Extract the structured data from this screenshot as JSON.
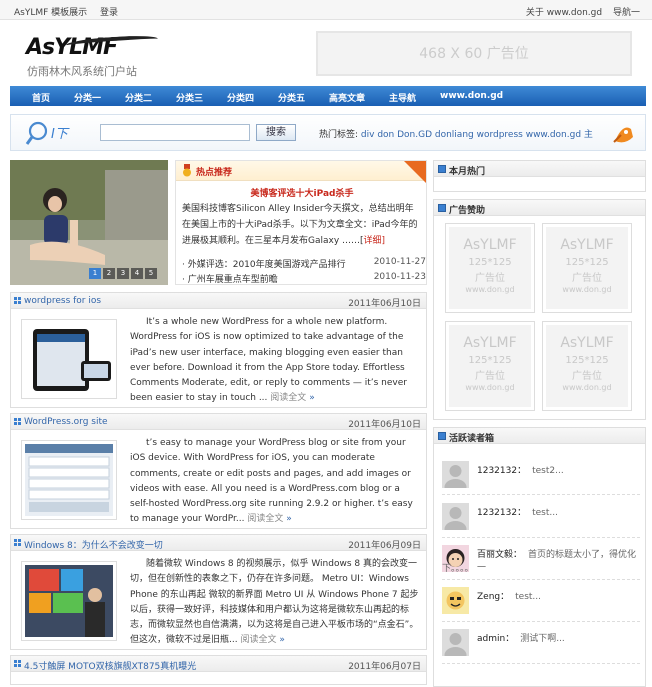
{
  "topbar": {
    "links": [
      "AsYLMF 模板展示",
      "登录"
    ],
    "right": [
      "关于 www.don.gd",
      "导航一"
    ]
  },
  "header": {
    "logo": "AsYLMF",
    "tagline": "仿雨林木风系统门户站",
    "ad": "468 X 60 广告位"
  },
  "nav": [
    "首页",
    "分类一",
    "分类二",
    "分类三",
    "分类四",
    "分类五",
    "高亮文章",
    "主导航",
    "www.don.gd"
  ],
  "search": {
    "button": "搜索",
    "tags_label": "热门标签:",
    "tags": "div don Don.GD donliang wordpress www.don.gd 主"
  },
  "slider": {
    "pages": [
      "1",
      "2",
      "3",
      "4",
      "5"
    ]
  },
  "hot": {
    "header": "热点推荐",
    "title": "美博客评选十大iPad杀手",
    "desc": "美国科技博客Silicon Alley Insider今天撰文，总结出明年在美国上市的十大iPad杀手。以下为文章全文：iPad今年的进展极其顺利。在三星本月发布Galaxy ……[",
    "more": "详细",
    "list": [
      {
        "title": "· 外媒评选：2010年度美国游戏产品排行",
        "date": "2010-11-27"
      },
      {
        "title": "· 广州车展重点车型前瞻",
        "date": "2010-11-23"
      }
    ]
  },
  "posts": [
    {
      "title": "wordpress for ios",
      "date": "2011年06月10日",
      "body": "It’s a whole new WordPress for a whole new platform. WordPress for iOS is now optimized to take advantage of the iPad’s new user interface, making blogging even easier than ever before. Download it from the App Store today. Effortless Comments Moderate, edit, or reply to comments — it’s never been easier to stay in touch ...",
      "read": "阅读全文",
      "arrow": "»"
    },
    {
      "title": "WordPress.org site",
      "date": "2011年06月10日",
      "body": "t’s easy to manage your WordPress blog or site from your iOS device. With WordPress for iOS, you can moderate comments, create or edit posts and pages, and add images or videos with ease. All you need is a WordPress.com blog or a self-hosted WordPress.org site running 2.9.2 or higher. t’s easy to manage your WordPr...",
      "read": "阅读全文",
      "arrow": "»"
    },
    {
      "title": "Windows 8：为什么不会改变一切",
      "date": "2011年06月09日",
      "body": "随着微软 Windows 8 的视频展示，似乎 Windows 8 真的会改变一切，但在创新性的表象之下，仍存在许多问题。 Metro UI：Windows Phone 的东山再起 微软的新界面 Metro UI 从 Windows Phone 7 起步以后，获得一致好评，科技媒体和用户都认为这将是微软东山再起的标志，而微软显然也自信满满，以为这将是自己进入平板市场的“点金石”。 但这次，微软不过是旧瓶...",
      "read": "阅读全文",
      "arrow": "»"
    },
    {
      "title": "4.5寸触屏 MOTO双核旗舰XT875真机曝光",
      "date": "2011年06月07日"
    }
  ],
  "sidebar": {
    "hot_title": "本月热门",
    "ad_title": "广告赞助",
    "ads": [
      {
        "name": "AsYLMF",
        "size": "125*125",
        "label": "广告位",
        "url": "www.don.gd"
      },
      {
        "name": "AsYLMF",
        "size": "125*125",
        "label": "广告位",
        "url": "www.don.gd"
      },
      {
        "name": "AsYLMF",
        "size": "125*125",
        "label": "广告位",
        "url": "www.don.gd"
      },
      {
        "name": "AsYLMF",
        "size": "125*125",
        "label": "广告位",
        "url": "www.don.gd"
      }
    ],
    "readers_title": "活跃读者箱",
    "readers": [
      {
        "name": "1232132：",
        "comment": "test2...",
        "line2": ""
      },
      {
        "name": "1232132：",
        "comment": "test...",
        "line2": ""
      },
      {
        "name": "百丽文毅：",
        "comment": "首页的标题太小了，得优化一",
        "line2": "下。。。。"
      },
      {
        "name": "Zeng：",
        "comment": "test...",
        "line2": ""
      },
      {
        "name": "admin：",
        "comment": "测试下啊...",
        "line2": ""
      }
    ]
  },
  "colors": {
    "nav": "#2b74c7",
    "accent": "#c8281c",
    "link": "#3366aa"
  }
}
